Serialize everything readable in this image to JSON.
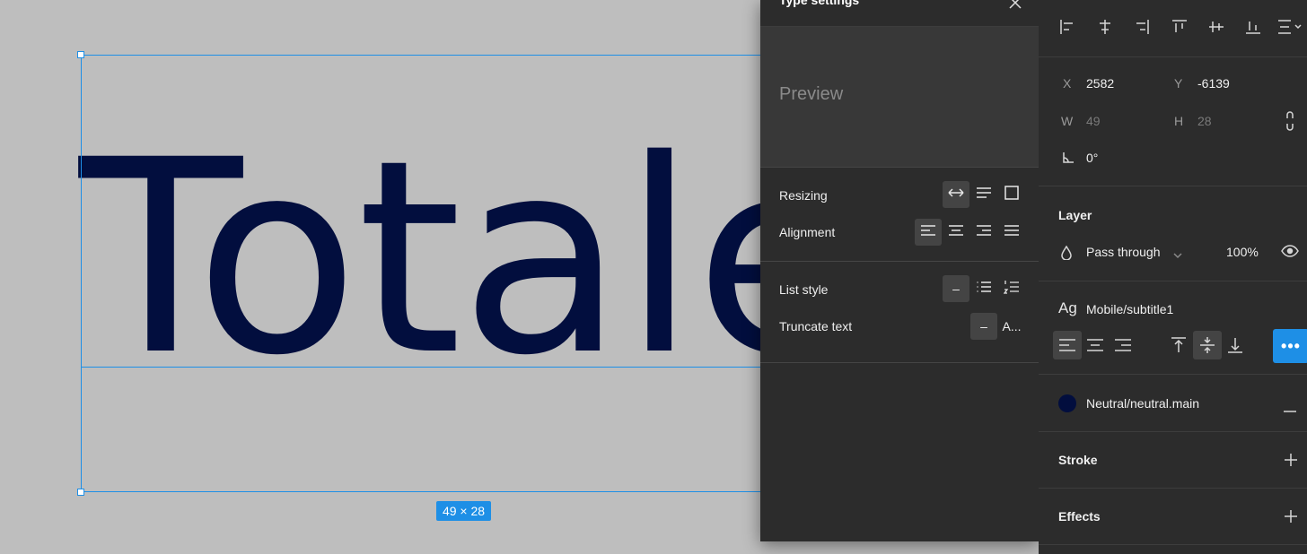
{
  "canvas": {
    "text": "Totale",
    "size_badge": "49 × 28",
    "text_color": "#020e3e",
    "selection_color": "#1e8fe6"
  },
  "type_settings": {
    "title": "Type settings",
    "preview": "Preview",
    "resizing_label": "Resizing",
    "alignment_label": "Alignment",
    "list_style_label": "List style",
    "truncate_label": "Truncate text",
    "list_none": "–",
    "truncate_none": "–",
    "truncate_ellipsis": "A..."
  },
  "properties": {
    "x_label": "X",
    "x_value": "2582",
    "y_label": "Y",
    "y_value": "-6139",
    "w_label": "W",
    "w_value": "49",
    "h_label": "H",
    "h_value": "28",
    "rotation_value": "0°",
    "layer_title": "Layer",
    "blend_mode": "Pass through",
    "opacity": "100%",
    "text_style_prefix": "Ag",
    "text_style_name": "Mobile/subtitle1",
    "fill_name": "Neutral/neutral.main",
    "fill_color": "#020e3e",
    "stroke_title": "Stroke",
    "effects_title": "Effects",
    "more_label": "•••"
  }
}
